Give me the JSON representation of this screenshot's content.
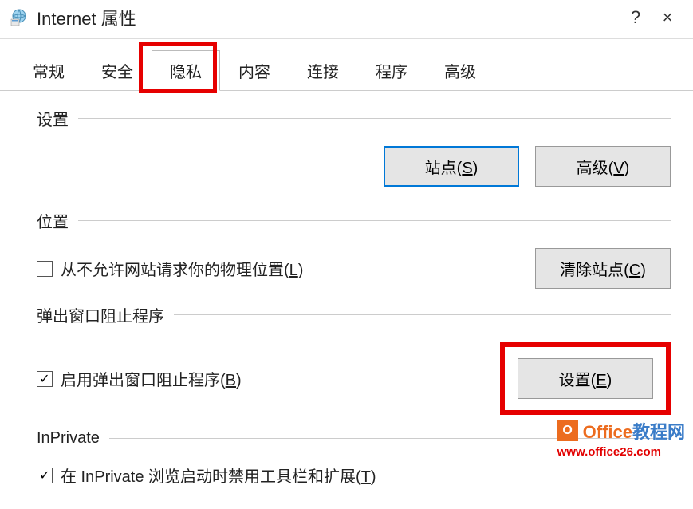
{
  "titlebar": {
    "title": "Internet 属性",
    "help": "?",
    "close": "×"
  },
  "tabs": [
    {
      "label": "常规"
    },
    {
      "label": "安全"
    },
    {
      "label": "隐私",
      "active": true
    },
    {
      "label": "内容"
    },
    {
      "label": "连接"
    },
    {
      "label": "程序"
    },
    {
      "label": "高级"
    }
  ],
  "sections": {
    "settings": {
      "label": "设置",
      "buttons": {
        "sites": {
          "text": "站点(",
          "key": "S",
          "suffix": ")"
        },
        "advanced": {
          "text": "高级(",
          "key": "V",
          "suffix": ")"
        }
      }
    },
    "location": {
      "label": "位置",
      "checkbox": {
        "text": "从不允许网站请求你的物理位置(",
        "key": "L",
        "suffix": ")",
        "checked": false
      },
      "button": {
        "text": "清除站点(",
        "key": "C",
        "suffix": ")"
      }
    },
    "popup": {
      "label": "弹出窗口阻止程序",
      "checkbox": {
        "text": "启用弹出窗口阻止程序(",
        "key": "B",
        "suffix": ")",
        "checked": true
      },
      "button": {
        "text": "设置(",
        "key": "E",
        "suffix": ")"
      }
    },
    "inprivate": {
      "label": "InPrivate",
      "checkbox": {
        "text": "在 InPrivate 浏览启动时禁用工具栏和扩展(",
        "key": "T",
        "suffix": ")",
        "checked": true
      }
    }
  },
  "watermark": {
    "brand_orange": "Office",
    "brand_blue": "教程网",
    "url": "www.office26.com",
    "icon_letter": "O"
  }
}
